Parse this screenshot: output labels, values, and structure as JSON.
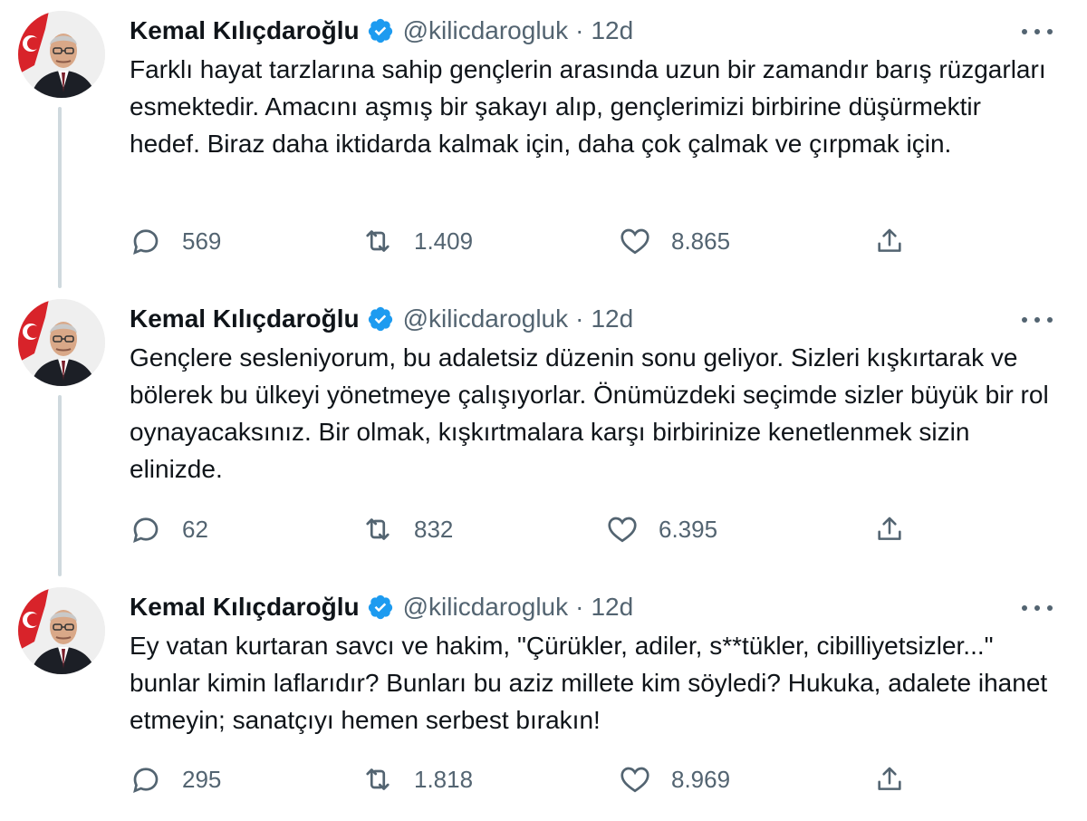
{
  "tweets": [
    {
      "author": "Kemal Kılıçdaroğlu",
      "handle": "@kilicdarogluk",
      "time": "12d",
      "text": "Farklı hayat tarzlarına sahip gençlerin arasında uzun bir zamandır barış rüzgarları esmektedir. Amacını aşmış bir şakayı alıp, gençlerimizi birbirine düşürmektir hedef. Biraz daha iktidarda kalmak için, daha çok çalmak ve çırpmak için.",
      "replies": "569",
      "retweets": "1.409",
      "likes": "8.865"
    },
    {
      "author": "Kemal Kılıçdaroğlu",
      "handle": "@kilicdarogluk",
      "time": "12d",
      "text": "Gençlere sesleniyorum, bu adaletsiz düzenin sonu geliyor. Sizleri kışkırtarak ve bölerek bu ülkeyi yönetmeye çalışıyorlar. Önümüzdeki seçimde sizler büyük bir rol oynayacaksınız. Bir olmak, kışkırtmalara karşı birbirinize kenetlenmek sizin elinizde.",
      "replies": "62",
      "retweets": "832",
      "likes": "6.395"
    },
    {
      "author": "Kemal Kılıçdaroğlu",
      "handle": "@kilicdarogluk",
      "time": "12d",
      "text": "Ey vatan kurtaran savcı ve hakim, \"Çürükler, adiler, s**tükler, cibilliyetsizler...\" bunlar kimin laflarıdır? Bunları bu aziz millete kim söyledi? Hukuka, adalete ihanet etmeyin; sanatçıyı hemen serbest bırakın!",
      "replies": "295",
      "retweets": "1.818",
      "likes": "8.969"
    }
  ],
  "separator": "·",
  "icons": {
    "verified": "verified-badge-icon",
    "more": "more-options-icon",
    "reply": "reply-icon",
    "retweet": "retweet-icon",
    "like": "like-icon",
    "share": "share-icon"
  },
  "colors": {
    "verified_blue": "#1d9bf0",
    "secondary_text": "#536471",
    "primary_text": "#0f1419",
    "thread_line": "#cfd9de",
    "flag_red": "#d8232a"
  }
}
